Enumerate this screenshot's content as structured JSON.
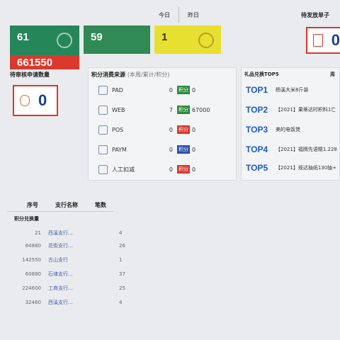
{
  "header": {
    "today": "今日",
    "yesterday": "昨日",
    "pending": "待发放单子"
  },
  "tiles": [
    {
      "value": "61"
    },
    {
      "value": "59"
    },
    {
      "value": "1"
    },
    {
      "value": "661550"
    }
  ],
  "pending_count": "0",
  "pending_review": {
    "label": "待审核申请数量",
    "count": "0"
  },
  "consume": {
    "title": "积分消费来源",
    "note": "(本周/累计/积分)",
    "tag_label": "积分",
    "rows": [
      {
        "name": "PAD",
        "count": "0",
        "tag_color": "#2d8a3e",
        "value": "0"
      },
      {
        "name": "WEB",
        "count": "7",
        "tag_color": "#2d8a3e",
        "value": "67000"
      },
      {
        "name": "POS",
        "count": "0",
        "tag_color": "#d8372d",
        "value": "0"
      },
      {
        "name": "PAYM",
        "count": "0",
        "tag_color": "#2b4fb0",
        "value": "0"
      },
      {
        "name": "人工扣减",
        "count": "0",
        "tag_color": "#d8372d",
        "value": "0"
      }
    ]
  },
  "gift": {
    "title": "礼品兑换TOP5",
    "week": "周",
    "items": [
      {
        "rank": "TOP1",
        "name": "杨溪大米8斤装"
      },
      {
        "rank": "TOP2",
        "name": "【2021】果蒂达时积料1亡"
      },
      {
        "rank": "TOP3",
        "name": "美的电饭煲"
      },
      {
        "rank": "TOP4",
        "name": "【2021】福牌先语精1.228"
      },
      {
        "rank": "TOP5",
        "name": "【2021】规达抽纸130抽+"
      }
    ]
  },
  "table": {
    "headers": [
      "序号",
      "支行名称",
      "笔数"
    ],
    "section": "积分兑换量",
    "rows": [
      [
        "21",
        "西溪支行...",
        "4"
      ],
      [
        "64880",
        "花街支行...",
        "26"
      ],
      [
        "142550",
        "古山支行",
        "1"
      ],
      [
        "60880",
        "石埭支行...",
        "37"
      ],
      [
        "224600",
        "工商支行...",
        "25"
      ],
      [
        "32460",
        "西溪支行...",
        "4"
      ]
    ]
  }
}
